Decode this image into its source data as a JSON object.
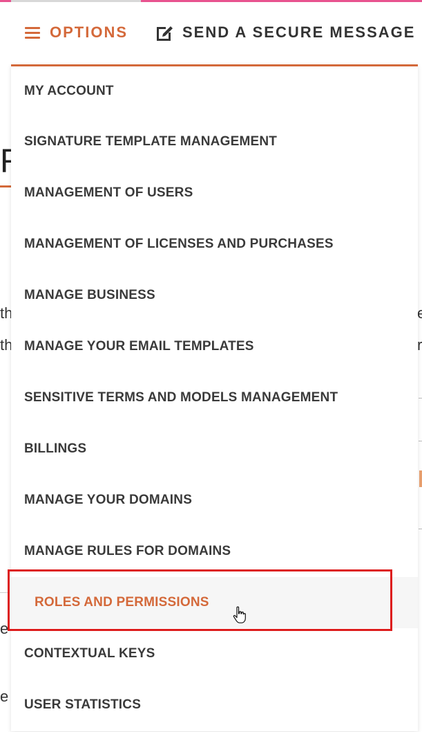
{
  "header": {
    "options_label": "OPTIONS",
    "secure_message_label": "SEND A SECURE MESSAGE",
    "options_icon": "hamburger-icon",
    "secure_message_icon": "edit-icon"
  },
  "background": {
    "title_fragment": "R",
    "left_fragment_1": "th",
    "left_fragment_2": "th",
    "left_fragment_3": "e",
    "left_fragment_4": "e",
    "right_fragment_1": "e",
    "right_fragment_2": "r"
  },
  "menu": {
    "items": [
      {
        "label": "MY ACCOUNT"
      },
      {
        "label": "SIGNATURE TEMPLATE MANAGEMENT"
      },
      {
        "label": "MANAGEMENT OF USERS"
      },
      {
        "label": "MANAGEMENT OF LICENSES AND PURCHASES"
      },
      {
        "label": "MANAGE BUSINESS"
      },
      {
        "label": "MANAGE YOUR EMAIL TEMPLATES"
      },
      {
        "label": "SENSITIVE TERMS AND MODELS MANAGEMENT"
      },
      {
        "label": "BILLINGS"
      },
      {
        "label": "MANAGE YOUR DOMAINS"
      },
      {
        "label": "MANAGE RULES FOR DOMAINS"
      },
      {
        "label": "ROLES AND PERMISSIONS"
      },
      {
        "label": "CONTEXTUAL KEYS"
      },
      {
        "label": "USER STATISTICS"
      }
    ],
    "active_index": 10
  },
  "colors": {
    "accent": "#d4693a",
    "highlight": "#dd1c1c",
    "top_accent": "#e8538f",
    "text": "#3a3a3a"
  }
}
